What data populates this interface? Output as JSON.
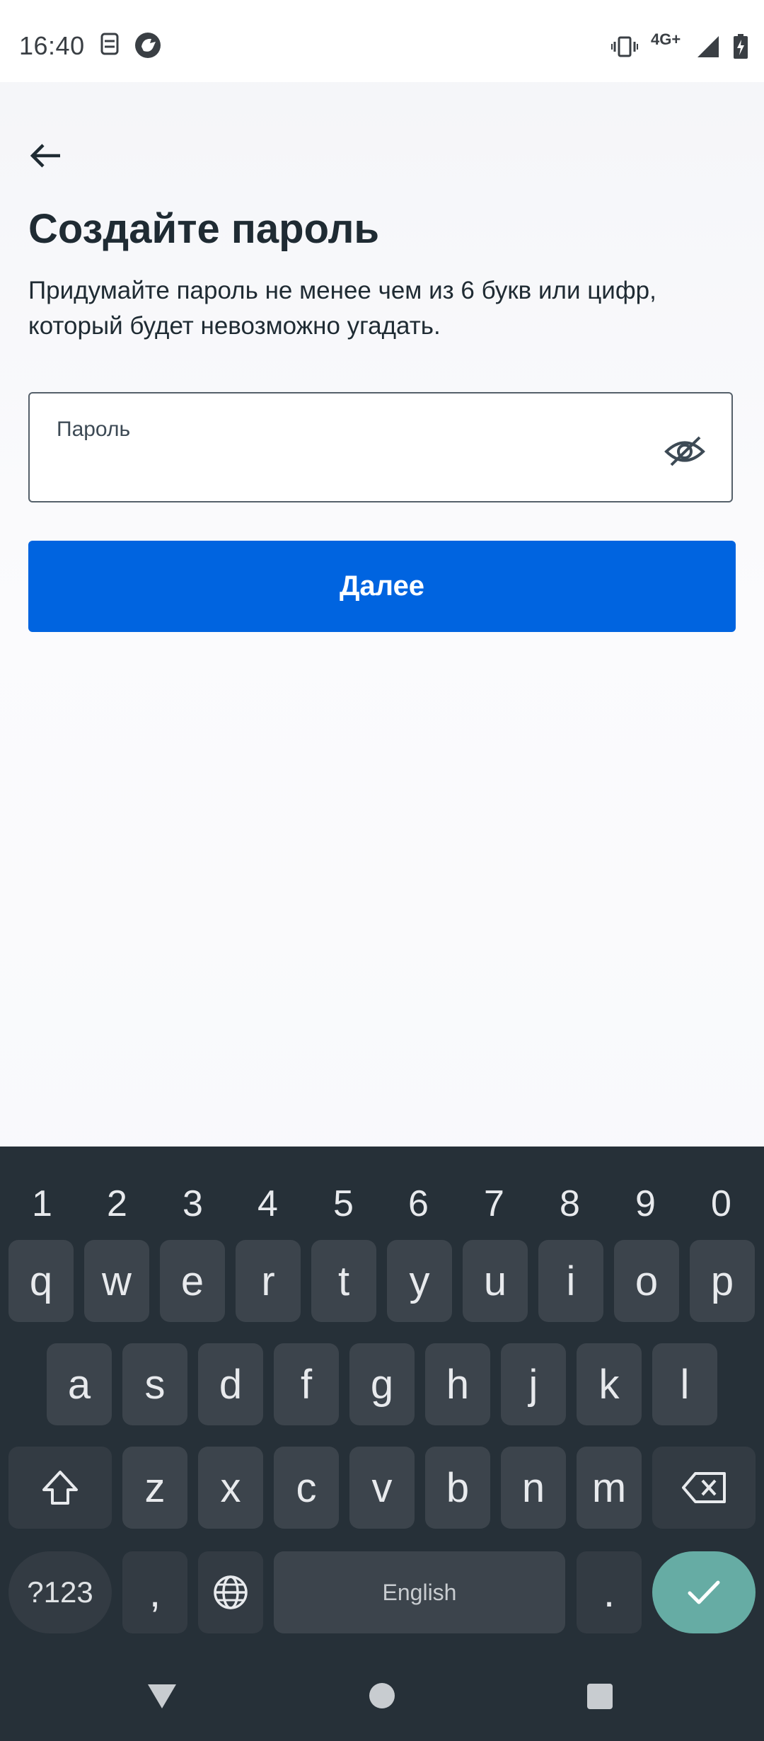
{
  "status_bar": {
    "time": "16:40",
    "network": "4G+",
    "left_icons": [
      "screenshot-sync-icon",
      "app-notification-icon"
    ],
    "right_icons": [
      "vibrate-icon",
      "signal-icon",
      "battery-charging-icon"
    ]
  },
  "screen": {
    "back_icon": "arrow-left-icon",
    "title": "Создайте пароль",
    "subtitle": "Придумайте пароль не менее чем из 6 букв или цифр, который будет невозможно угадать.",
    "password_field": {
      "label": "Пароль",
      "value": "",
      "visibility_icon": "eye-off-icon"
    },
    "next_button": "Далее"
  },
  "keyboard": {
    "numbers": [
      "1",
      "2",
      "3",
      "4",
      "5",
      "6",
      "7",
      "8",
      "9",
      "0"
    ],
    "row1": [
      "q",
      "w",
      "e",
      "r",
      "t",
      "y",
      "u",
      "i",
      "o",
      "p"
    ],
    "row2": [
      "a",
      "s",
      "d",
      "f",
      "g",
      "h",
      "j",
      "k",
      "l"
    ],
    "row3": [
      "z",
      "x",
      "c",
      "v",
      "b",
      "n",
      "m"
    ],
    "symbols_key": "?123",
    "comma_key": ",",
    "space_key": "English",
    "period_key": "."
  },
  "colors": {
    "primary_button": "#0064e0",
    "keyboard_bg": "#263038",
    "key_bg": "#3c444c",
    "enter_key": "#66aca4",
    "text_dark": "#1f2b33"
  }
}
